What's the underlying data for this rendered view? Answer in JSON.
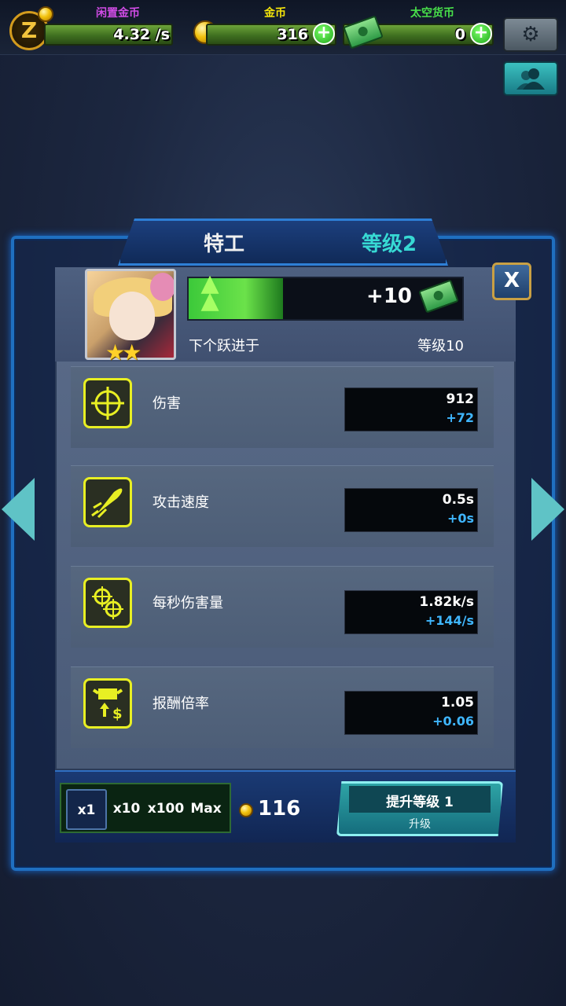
{
  "topbar": {
    "idle": {
      "label": "闲置金币",
      "value": "4.32 /s",
      "label_color": "#d14ce6"
    },
    "gold": {
      "label": "金币",
      "value": "316",
      "label_color": "#f4e40b"
    },
    "space": {
      "label": "太空货币",
      "value": "0",
      "label_color": "#48e04a"
    },
    "plus_symbol": "+",
    "settings_icon": "gear-icon",
    "profile_icon": "user-icon"
  },
  "panel": {
    "name": "特工",
    "level": "等级2",
    "close_label": "X",
    "reward": "+10",
    "next_label": "下个跃进于",
    "next_level": "等级10",
    "stars": "★★"
  },
  "stats": [
    {
      "label": "伤害",
      "value": "912",
      "delta": "+72",
      "icon": "crosshair-icon"
    },
    {
      "label": "攻击速度",
      "value": "0.5s",
      "delta": "+0s",
      "icon": "rocket-icon"
    },
    {
      "label": "每秒伤害量",
      "value": "1.82k/s",
      "delta": "+144/s",
      "icon": "double-crosshair-icon"
    },
    {
      "label": "报酬倍率",
      "value": "1.05",
      "delta": "+0.06",
      "icon": "money-up-icon"
    }
  ],
  "multiplier": {
    "options": [
      "x1",
      "x10",
      "x100",
      "Max"
    ],
    "selected": "x1"
  },
  "cost": "116",
  "upgrade": {
    "title": "提升等级 1",
    "subtitle": "升级"
  },
  "colors": {
    "accent": "#37d9d3",
    "delta": "#3fb6ff",
    "icon_yellow": "#e8ef23"
  }
}
